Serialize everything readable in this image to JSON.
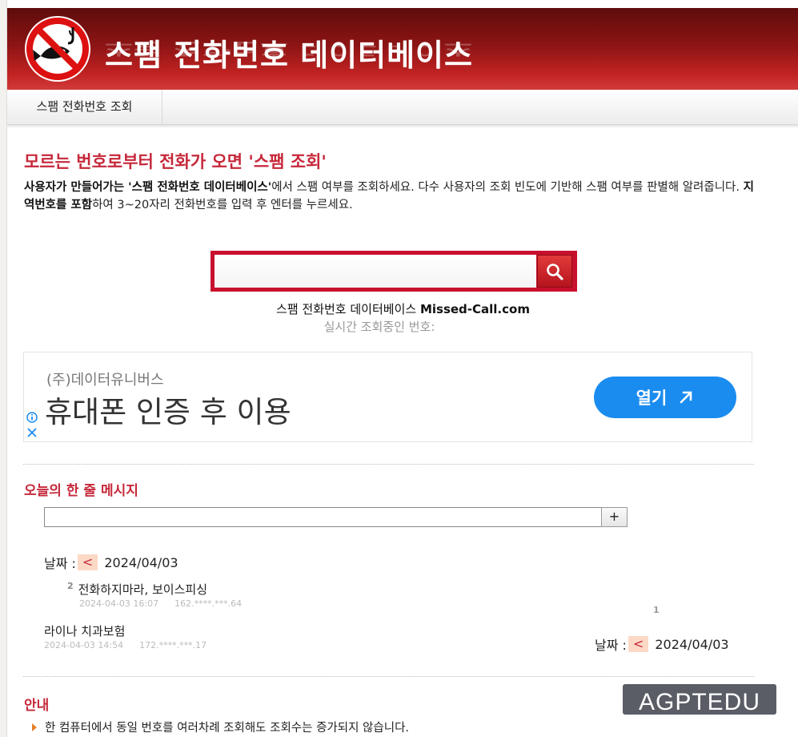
{
  "header": {
    "site_title": "스팸 전화번호 데이터베이스"
  },
  "nav": {
    "items": [
      {
        "label": "스팸 전화번호 조회"
      }
    ]
  },
  "intro": {
    "headline": "모르는 번호로부터 전화가 오면 '스팸 조회'",
    "p1_bold": "사용자가 만들어가는 '스팸 전화번호 데이터베이스'",
    "p1_text": "에서 스팸 여부를 조회하세요. 다수 사용자의 조회 빈도에 기반해 스팸 여부를 판별해 알려줍니다. ",
    "p2_bold": "지역번호를 포함",
    "p2_text": "하여 3~20자리 전화번호를 입력 후 엔터를 누르세요."
  },
  "search": {
    "value": "",
    "placeholder": "",
    "button_icon": "search-icon"
  },
  "brand": {
    "prefix": "스팸 전화번호 데이터베이스",
    "domain": "Missed-Call.com",
    "live_label": "실시간 조회중인 번호:"
  },
  "ad": {
    "company": "(주)데이터유니버스",
    "title": "휴대폰 인증 후 이용",
    "button_label": "열기"
  },
  "message_section": {
    "title": "오늘의 한 줄 메시지",
    "input_value": "",
    "add_label": "+",
    "date_label": "날짜 :",
    "prev_label": "<",
    "date": "2024/04/03",
    "messages": [
      {
        "count": "2",
        "text": "전화하지마라, 보이스피싱",
        "timestamp": "2024-04-03 16:07",
        "ip": "162.****.***.64"
      },
      {
        "count": "",
        "text": "라이나 치과보험",
        "timestamp": "2024-04-03 14:54",
        "ip": "172.****.***.17"
      }
    ],
    "page_number": "1"
  },
  "guide": {
    "title": "안내",
    "items": [
      "한 컴퓨터에서 동일 번호를 여러차례 조회해도 조회수는 증가되지 않습니다."
    ]
  },
  "watermark": "AGPTEDU",
  "colors": {
    "accent": "#c6283a",
    "header_dark": "#5e0c0c",
    "header_light": "#d23a3a",
    "ad_button": "#1a8cf0",
    "date_button_bg": "#fbd9c6"
  }
}
